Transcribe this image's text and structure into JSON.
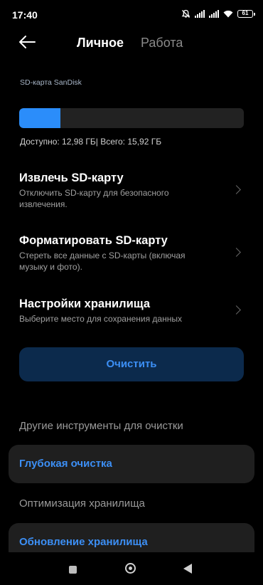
{
  "status_bar": {
    "time": "17:40",
    "battery": "61",
    "icons": [
      "mute-icon",
      "signal-icon",
      "signal-icon",
      "wifi-icon",
      "battery-icon"
    ]
  },
  "header": {
    "back_icon": "arrow-left-icon",
    "tab_active": "Личное",
    "tab_inactive": "Работа"
  },
  "storage": {
    "sd_label": "SD-карта SanDisk",
    "used_fraction": 0.185,
    "bar_color": "#2b8dfa",
    "available_text": "Доступно: 12,98 ГБ| Всего: 15,92 ГБ"
  },
  "items": [
    {
      "title": "Извлечь SD-карту",
      "desc": "Отключить SD-карту для безопасного извлечения."
    },
    {
      "title": "Форматировать SD-карту",
      "desc": "Стереть все данные с SD-карты (включая музыку и фото)."
    },
    {
      "title": "Настройки хранилища",
      "desc": "Выберите место для сохранения данных"
    }
  ],
  "clean_button": {
    "label": "Очистить",
    "color": "#0c2a4c"
  },
  "other_tools": {
    "section_title": "Другие инструменты для очистки",
    "deep_clean": "Глубокая очистка",
    "optimization_title": "Оптимизация хранилища",
    "update_storage": "Обновление хранилища"
  },
  "accent_color": "#3c8ff5",
  "nav_bar": {
    "icons": [
      "recents-icon",
      "home-icon",
      "back-icon"
    ]
  }
}
